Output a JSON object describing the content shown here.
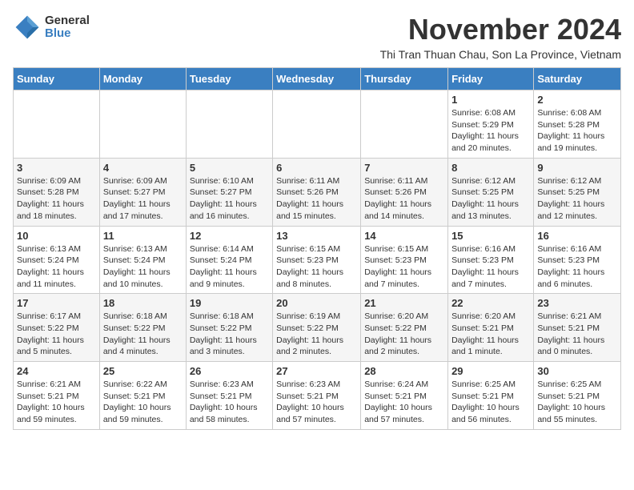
{
  "logo": {
    "general": "General",
    "blue": "Blue"
  },
  "header": {
    "title": "November 2024",
    "subtitle": "Thi Tran Thuan Chau, Son La Province, Vietnam"
  },
  "weekdays": [
    "Sunday",
    "Monday",
    "Tuesday",
    "Wednesday",
    "Thursday",
    "Friday",
    "Saturday"
  ],
  "weeks": [
    [
      {
        "day": "",
        "info": ""
      },
      {
        "day": "",
        "info": ""
      },
      {
        "day": "",
        "info": ""
      },
      {
        "day": "",
        "info": ""
      },
      {
        "day": "",
        "info": ""
      },
      {
        "day": "1",
        "info": "Sunrise: 6:08 AM\nSunset: 5:29 PM\nDaylight: 11 hours and 20 minutes."
      },
      {
        "day": "2",
        "info": "Sunrise: 6:08 AM\nSunset: 5:28 PM\nDaylight: 11 hours and 19 minutes."
      }
    ],
    [
      {
        "day": "3",
        "info": "Sunrise: 6:09 AM\nSunset: 5:28 PM\nDaylight: 11 hours and 18 minutes."
      },
      {
        "day": "4",
        "info": "Sunrise: 6:09 AM\nSunset: 5:27 PM\nDaylight: 11 hours and 17 minutes."
      },
      {
        "day": "5",
        "info": "Sunrise: 6:10 AM\nSunset: 5:27 PM\nDaylight: 11 hours and 16 minutes."
      },
      {
        "day": "6",
        "info": "Sunrise: 6:11 AM\nSunset: 5:26 PM\nDaylight: 11 hours and 15 minutes."
      },
      {
        "day": "7",
        "info": "Sunrise: 6:11 AM\nSunset: 5:26 PM\nDaylight: 11 hours and 14 minutes."
      },
      {
        "day": "8",
        "info": "Sunrise: 6:12 AM\nSunset: 5:25 PM\nDaylight: 11 hours and 13 minutes."
      },
      {
        "day": "9",
        "info": "Sunrise: 6:12 AM\nSunset: 5:25 PM\nDaylight: 11 hours and 12 minutes."
      }
    ],
    [
      {
        "day": "10",
        "info": "Sunrise: 6:13 AM\nSunset: 5:24 PM\nDaylight: 11 hours and 11 minutes."
      },
      {
        "day": "11",
        "info": "Sunrise: 6:13 AM\nSunset: 5:24 PM\nDaylight: 11 hours and 10 minutes."
      },
      {
        "day": "12",
        "info": "Sunrise: 6:14 AM\nSunset: 5:24 PM\nDaylight: 11 hours and 9 minutes."
      },
      {
        "day": "13",
        "info": "Sunrise: 6:15 AM\nSunset: 5:23 PM\nDaylight: 11 hours and 8 minutes."
      },
      {
        "day": "14",
        "info": "Sunrise: 6:15 AM\nSunset: 5:23 PM\nDaylight: 11 hours and 7 minutes."
      },
      {
        "day": "15",
        "info": "Sunrise: 6:16 AM\nSunset: 5:23 PM\nDaylight: 11 hours and 7 minutes."
      },
      {
        "day": "16",
        "info": "Sunrise: 6:16 AM\nSunset: 5:23 PM\nDaylight: 11 hours and 6 minutes."
      }
    ],
    [
      {
        "day": "17",
        "info": "Sunrise: 6:17 AM\nSunset: 5:22 PM\nDaylight: 11 hours and 5 minutes."
      },
      {
        "day": "18",
        "info": "Sunrise: 6:18 AM\nSunset: 5:22 PM\nDaylight: 11 hours and 4 minutes."
      },
      {
        "day": "19",
        "info": "Sunrise: 6:18 AM\nSunset: 5:22 PM\nDaylight: 11 hours and 3 minutes."
      },
      {
        "day": "20",
        "info": "Sunrise: 6:19 AM\nSunset: 5:22 PM\nDaylight: 11 hours and 2 minutes."
      },
      {
        "day": "21",
        "info": "Sunrise: 6:20 AM\nSunset: 5:22 PM\nDaylight: 11 hours and 2 minutes."
      },
      {
        "day": "22",
        "info": "Sunrise: 6:20 AM\nSunset: 5:21 PM\nDaylight: 11 hours and 1 minute."
      },
      {
        "day": "23",
        "info": "Sunrise: 6:21 AM\nSunset: 5:21 PM\nDaylight: 11 hours and 0 minutes."
      }
    ],
    [
      {
        "day": "24",
        "info": "Sunrise: 6:21 AM\nSunset: 5:21 PM\nDaylight: 10 hours and 59 minutes."
      },
      {
        "day": "25",
        "info": "Sunrise: 6:22 AM\nSunset: 5:21 PM\nDaylight: 10 hours and 59 minutes."
      },
      {
        "day": "26",
        "info": "Sunrise: 6:23 AM\nSunset: 5:21 PM\nDaylight: 10 hours and 58 minutes."
      },
      {
        "day": "27",
        "info": "Sunrise: 6:23 AM\nSunset: 5:21 PM\nDaylight: 10 hours and 57 minutes."
      },
      {
        "day": "28",
        "info": "Sunrise: 6:24 AM\nSunset: 5:21 PM\nDaylight: 10 hours and 57 minutes."
      },
      {
        "day": "29",
        "info": "Sunrise: 6:25 AM\nSunset: 5:21 PM\nDaylight: 10 hours and 56 minutes."
      },
      {
        "day": "30",
        "info": "Sunrise: 6:25 AM\nSunset: 5:21 PM\nDaylight: 10 hours and 55 minutes."
      }
    ]
  ]
}
